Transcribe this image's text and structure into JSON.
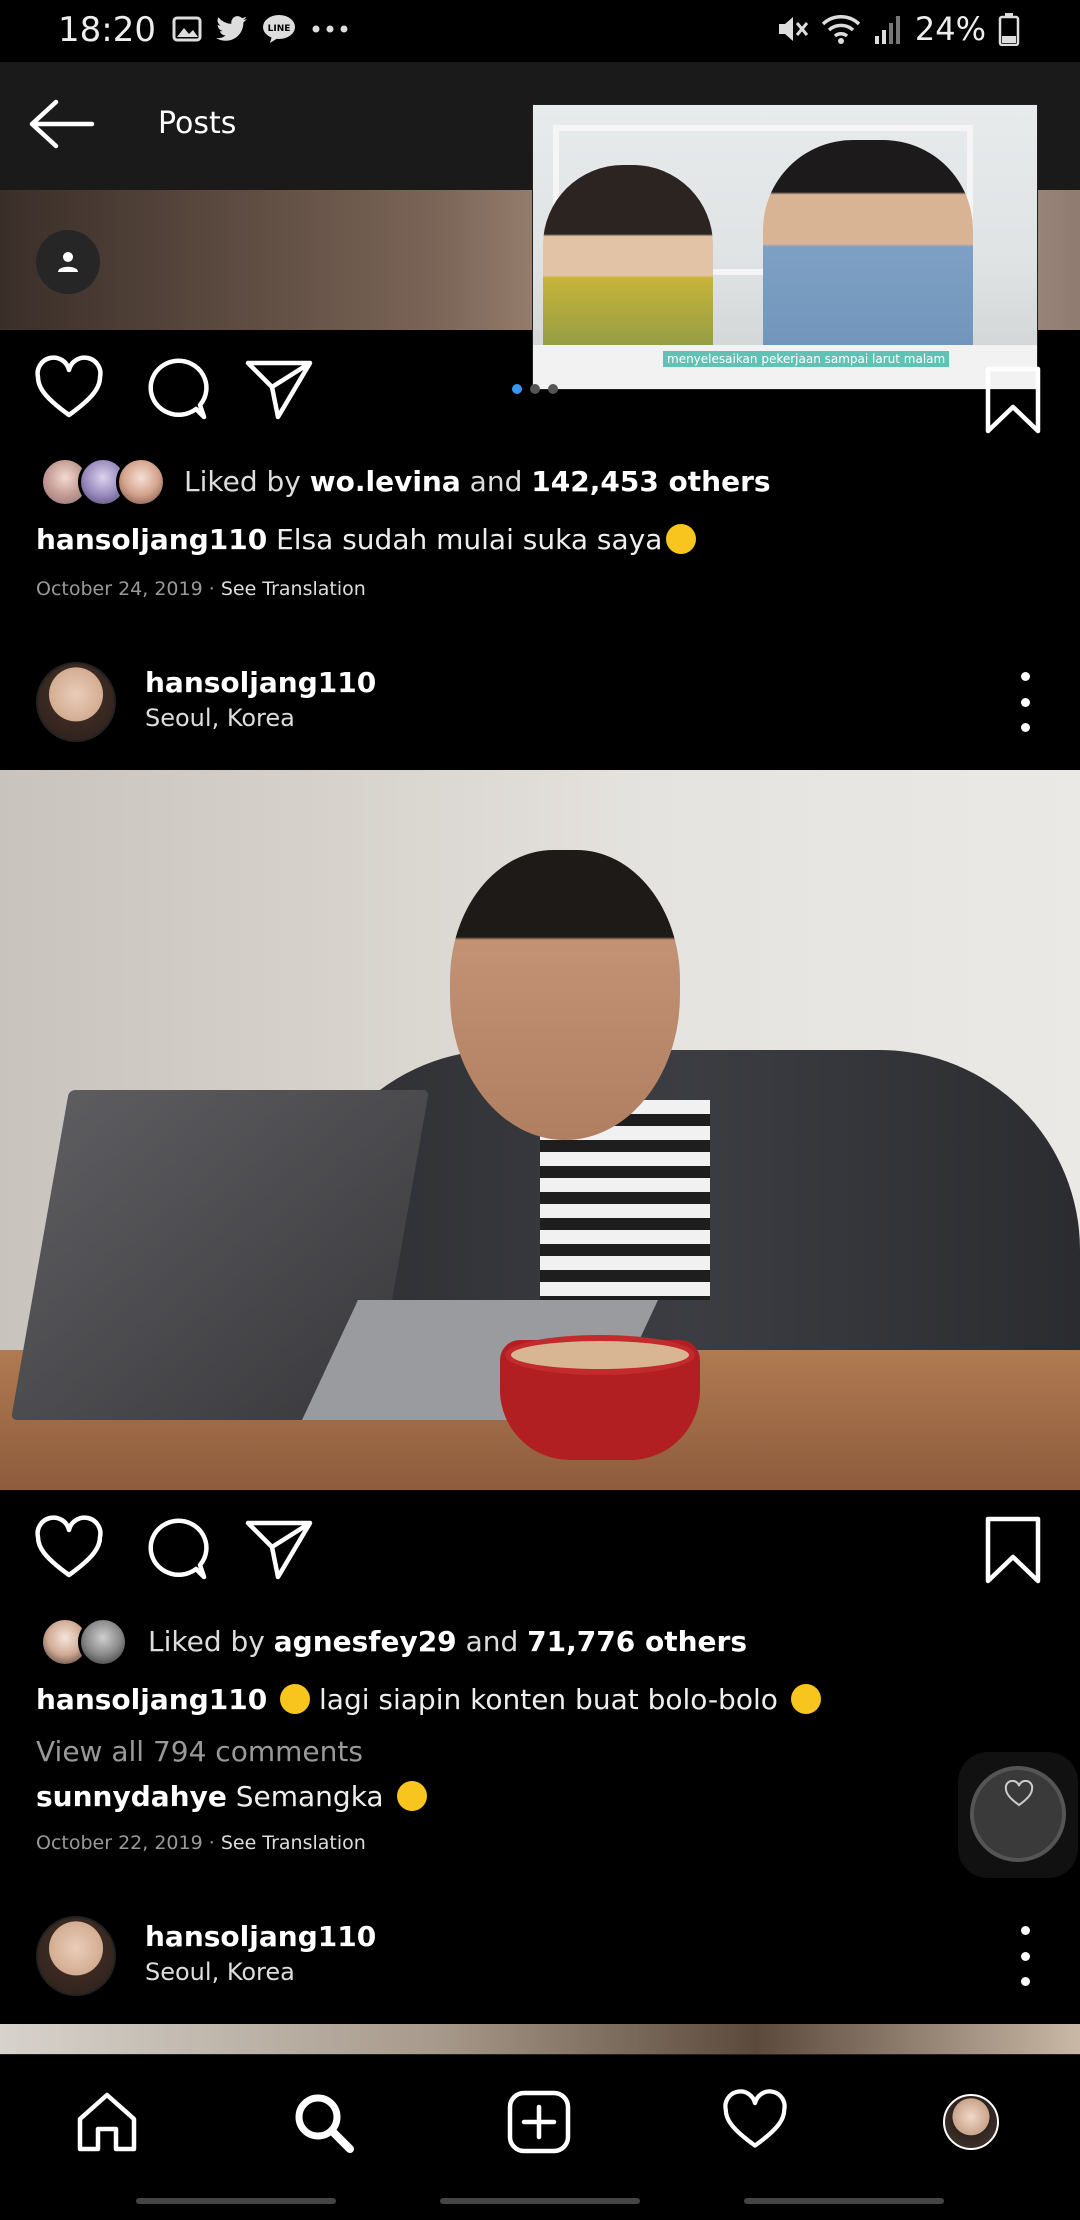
{
  "status_bar": {
    "time": "18:20",
    "battery": "24%",
    "left_icons": [
      "image-icon",
      "twitter-icon",
      "line-icon",
      "more-icon"
    ],
    "right_icons": [
      "mute-icon",
      "wifi-icon",
      "signal-icon",
      "battery-icon"
    ]
  },
  "header": {
    "title": "Posts"
  },
  "pip_video": {
    "caption": "menyelesaikan pekerjaan sampai larut malam"
  },
  "post1": {
    "likes_prefix": "Liked by",
    "liked_by": "wo.levina",
    "likes_and": "and",
    "likes_count": "142,453 others",
    "caption_user": "hansoljang110",
    "caption_text": "Elsa sudah mulai suka saya",
    "date": "October 24, 2019",
    "see_translation": "See Translation"
  },
  "post2": {
    "username": "hansoljang110",
    "location": "Seoul, Korea",
    "likes_prefix": "Liked by",
    "liked_by": "agnesfey29",
    "likes_and": "and",
    "likes_count": "71,776 others",
    "caption_user": "hansoljang110",
    "caption_text": "lagi siapin konten buat bolo-bolo",
    "view_comments": "View all 794 comments",
    "comment_user": "sunnydahye",
    "comment_text": "Semangka",
    "date": "October 22, 2019",
    "see_translation": "See Translation"
  },
  "post3": {
    "username": "hansoljang110",
    "location": "Seoul, Korea"
  },
  "colors": {
    "accent": "#3897f0",
    "background": "#000000",
    "header": "#1a1a1a"
  }
}
